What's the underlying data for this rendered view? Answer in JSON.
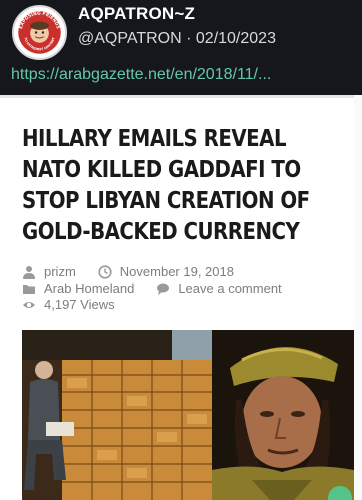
{
  "post": {
    "display_name": "AQPATRON~Z",
    "handle": "@AQPATRON",
    "separator": "·",
    "date": "02/10/2023",
    "link": "https://arabgazette.net/en/2018/11/...",
    "avatar_icon": "exposing-friends-of-extremist-content-badge",
    "avatar_text_top": "EXPOSING FRIENDS",
    "avatar_text_bottom": "TO EXTREMIST CONTENT",
    "colors": {
      "background": "#15171c",
      "link": "#64c8a7",
      "name": "#ffffff"
    }
  },
  "article": {
    "title": "Hillary Emails Reveal NATO Killed Gaddafi to Stop Libyan Creation of Gold-Backed Currency",
    "author_icon": "user-icon",
    "author": "prizm",
    "date_icon": "clock-icon",
    "date": "November 19, 2018",
    "category_icon": "folder-icon",
    "category": "Arab Homeland",
    "comment_icon": "comment-icon",
    "comment_label": "Leave a comment",
    "views_icon": "eye-icon",
    "views": "4,197 Views"
  },
  "images": {
    "left": "man-seated-beside-gold-bar-stacks",
    "right": "portrait-of-man-in-military-cap"
  }
}
